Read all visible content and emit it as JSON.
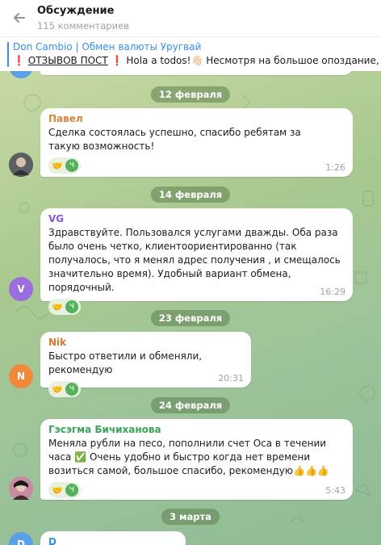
{
  "header": {
    "title": "Обсуждение",
    "subtitle": "115 комментариев"
  },
  "pinned": {
    "title": "Don Cambio | Обмен валюты Уругвай",
    "mark_left": "❗",
    "reviews_label": "ОТЗЫВОВ ПОСТ",
    "mark_right": "❗",
    "preview": "Hola a todos!👋🏻  Несмотря на большое опоздание, Don Ca"
  },
  "dates": [
    "12 февраля",
    "14 февраля",
    "23 февраля",
    "24 февраля",
    "3 марта"
  ],
  "messages": [
    {
      "author": "Павел",
      "author_color": "#d9843b",
      "text": "Сделка состоялась успешно, спасибо ребятам за такую возможность!",
      "time": "1:26",
      "reaction_emoji": "🤝",
      "reaction_user": "Ч"
    },
    {
      "author": "VG",
      "author_color": "#8a56d6",
      "text": "Здравствуйте. Пользовался услугами дважды. Оба раза было очень четко, клиентоориентированно (так получалось, что я менял адрес получения , и смещалось значительно время). Удобный вариант обмена, порядочный.",
      "time": "16:29",
      "reaction_emoji": "🤝",
      "reaction_user": "Ч",
      "avatar_letter": "V",
      "avatar_color": "#9b6ee0"
    },
    {
      "author": "Nik",
      "author_color": "#e0762b",
      "text": "Быстро ответили и обменяли, рекомендую",
      "time": "20:31",
      "reaction_emoji": "🤝",
      "reaction_user": "Ч",
      "avatar_letter": "N",
      "avatar_color": "#f08a3a"
    },
    {
      "author": "Гэсэгма Бичиханова",
      "author_color": "#3aa35a",
      "text": "Меняла рубли на песо, пополнили счет Оса в течении часа ✅ Очень удобно и быстро когда нет времени возиться самой, большое спасибо, рекомендую👍👍👍",
      "time": "5:43",
      "reaction_emoji": "🤝",
      "reaction_user": "Ч"
    }
  ],
  "partial_next": {
    "avatar_letter": "D",
    "avatar_color": "#5aa0e6",
    "author": "D"
  },
  "colors": {
    "accent": "#3390ec",
    "header_bg": "#ffffff"
  }
}
